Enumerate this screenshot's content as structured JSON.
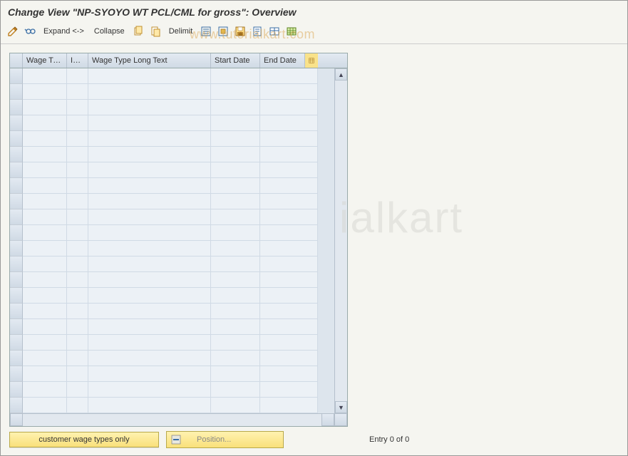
{
  "title": "Change View \"NP-SYOYO WT PCL/CML for gross\": Overview",
  "toolbar": {
    "expand": "Expand <->",
    "collapse": "Collapse",
    "delimit": "Delimit"
  },
  "icons": {
    "pencil": "pencil-toggle-icon",
    "glasses": "display-icon",
    "copy": "copy-icon",
    "copy2": "paste-icon",
    "nav1": "select-all-icon",
    "nav2": "deselect-all-icon",
    "save": "save-icon",
    "doc": "doc-icon",
    "grid": "grid-settings-icon",
    "table": "table-icon"
  },
  "table": {
    "headers": {
      "wtype": "Wage Ty...",
      "inf": "Inf...",
      "long": "Wage Type Long Text",
      "start": "Start Date",
      "end": "End Date"
    },
    "row_count": 22
  },
  "footer": {
    "customer_btn": "customer wage types only",
    "position_btn": "Position...",
    "entry_text": "Entry 0 of 0"
  },
  "watermark": "www.tutorialkart.com",
  "watermark2": "ialkart"
}
